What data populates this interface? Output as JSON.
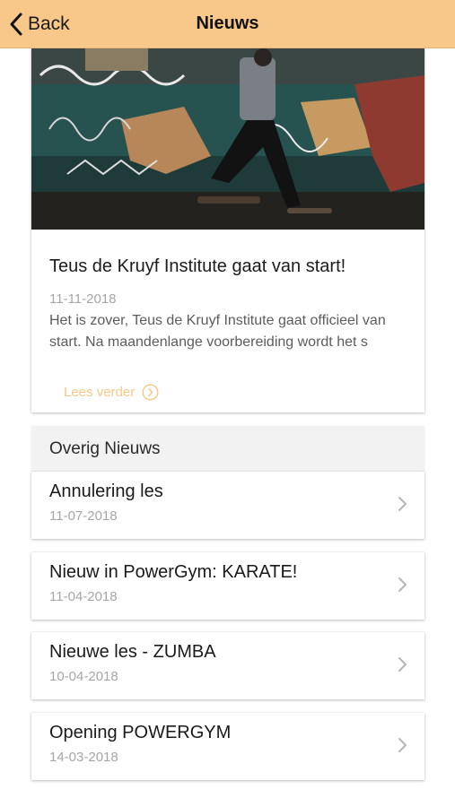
{
  "header": {
    "back_label": "Back",
    "title": "Nieuws"
  },
  "featured": {
    "title": "Teus de Kruyf Institute gaat van start!",
    "date": "11-11-2018",
    "excerpt": "Het is zover, Teus de Kruyf Institute gaat officieel van start. Na maandenlange voorbereiding wordt het s",
    "read_more_label": "Lees verder"
  },
  "section": {
    "label": "Overig Nieuws"
  },
  "news_items": [
    {
      "title": "Annulering les",
      "date": "11-07-2018"
    },
    {
      "title": "Nieuw in PowerGym: KARATE!",
      "date": "11-04-2018"
    },
    {
      "title": "Nieuwe les - ZUMBA",
      "date": "10-04-2018"
    },
    {
      "title": "Opening POWERGYM",
      "date": "14-03-2018"
    }
  ],
  "colors": {
    "navbar": "#f7c889",
    "accent": "#f7c889",
    "date_text": "#a6a6a6"
  }
}
